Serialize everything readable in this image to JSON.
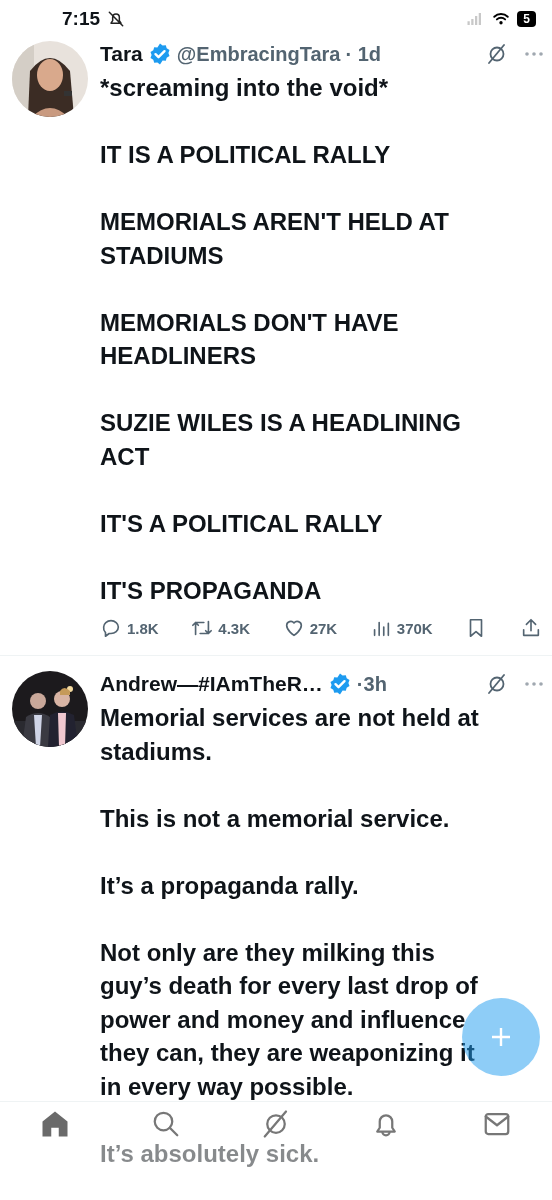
{
  "status_bar": {
    "time": "7:15",
    "battery": "5"
  },
  "tweets": [
    {
      "author": "Tara",
      "verified": true,
      "handle": "@EmbracingTara",
      "time": "· 1d",
      "paragraphs": [
        "*screaming into the void*",
        "IT IS A POLITICAL RALLY",
        "MEMORIALS AREN'T HELD AT STADIUMS",
        "MEMORIALS DON'T HAVE HEADLINERS",
        "SUZIE WILES IS A HEADLINING ACT",
        "IT'S A POLITICAL RALLY",
        "IT'S PROPAGANDA"
      ],
      "stats": [
        {
          "kind": "reply",
          "count": "1.8K"
        },
        {
          "kind": "repost",
          "count": "4.3K"
        },
        {
          "kind": "like",
          "count": "27K"
        },
        {
          "kind": "views",
          "count": "370K"
        },
        {
          "kind": "bookmark"
        },
        {
          "kind": "share"
        }
      ]
    },
    {
      "author": "Andrew—#IAmTheR…",
      "verified": true,
      "time": "·3h",
      "paragraphs": [
        "Memorial services are not held at stadiums.",
        "This is not a memorial service.",
        "It’s a propaganda rally.",
        "Not only are they milking this guy’s death for every last drop of power and money and influence they can, they are weaponizing it in every way possible.",
        "It’s absolutely sick."
      ]
    }
  ],
  "nav": [
    {
      "kind": "home",
      "selected": true
    },
    {
      "kind": "search",
      "selected": false
    },
    {
      "kind": "grok",
      "selected": false
    },
    {
      "kind": "notifications",
      "selected": false
    },
    {
      "kind": "messages",
      "selected": false
    }
  ]
}
